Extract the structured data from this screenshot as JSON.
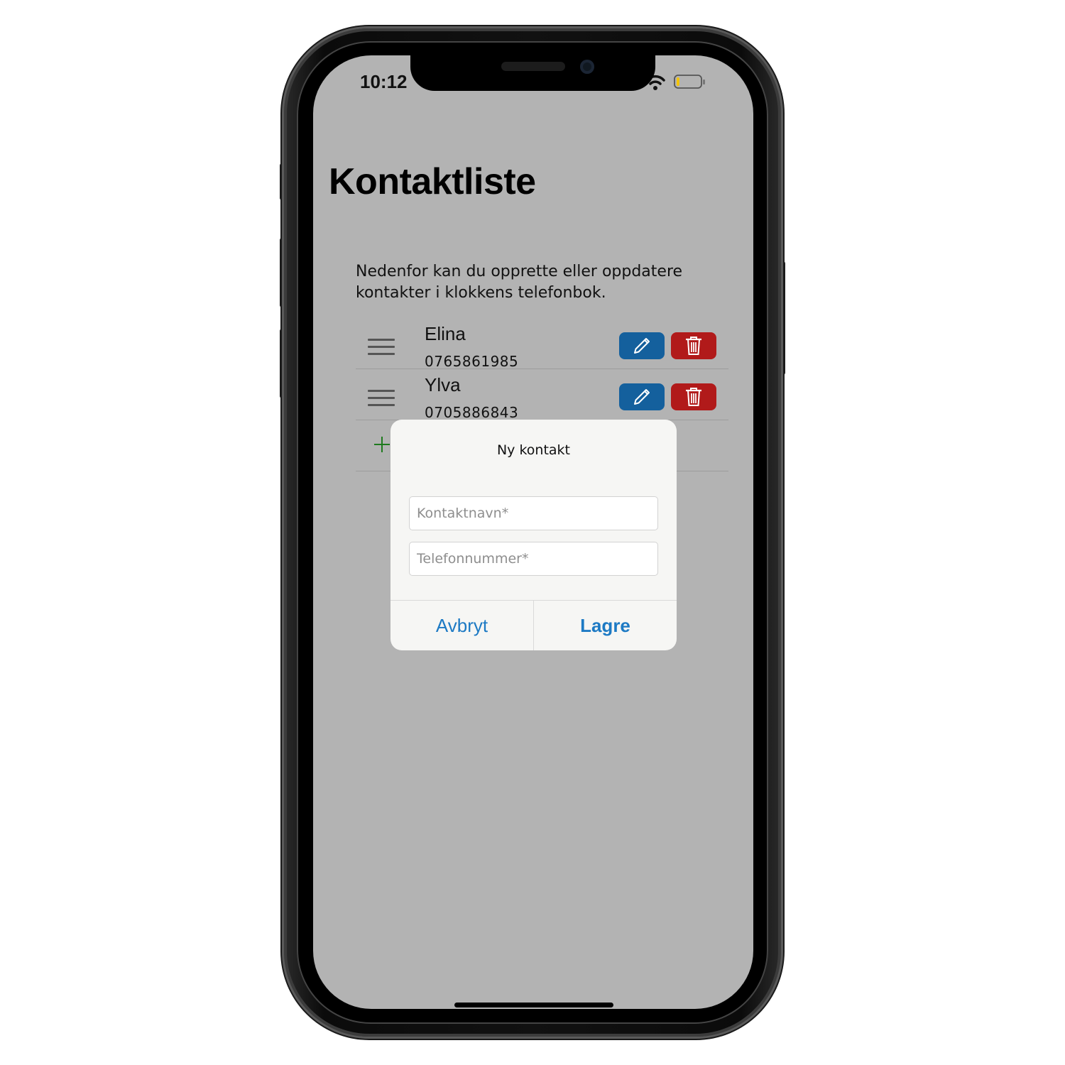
{
  "status_bar": {
    "time": "10:12"
  },
  "page": {
    "title": "Kontaktliste",
    "intro": "Nedenfor kan du opprette eller oppdatere kontakter i klokkens telefonbok."
  },
  "contacts": [
    {
      "name": "Elina",
      "phone": "0765861985"
    },
    {
      "name": "Ylva",
      "phone": "0705886843"
    }
  ],
  "icons": {
    "drag_handle": "drag-handle-icon",
    "edit": "pencil-icon",
    "delete": "trash-icon",
    "add": "plus-icon",
    "signal": "cellular-signal-icon",
    "wifi": "wifi-icon",
    "battery": "battery-icon"
  },
  "colors": {
    "edit_button": "#14609d",
    "delete_button": "#b11a1a",
    "add_icon": "#1e7a1e",
    "dialog_link": "#1d7ac4",
    "screen_overlay": "#b3b3b3",
    "battery_fill": "#f5c400"
  },
  "battery_level": 0.12,
  "dialog": {
    "title": "Ny kontakt",
    "name_placeholder": "Kontaktnavn*",
    "phone_placeholder": "Telefonnummer*",
    "cancel_label": "Avbryt",
    "save_label": "Lagre"
  }
}
